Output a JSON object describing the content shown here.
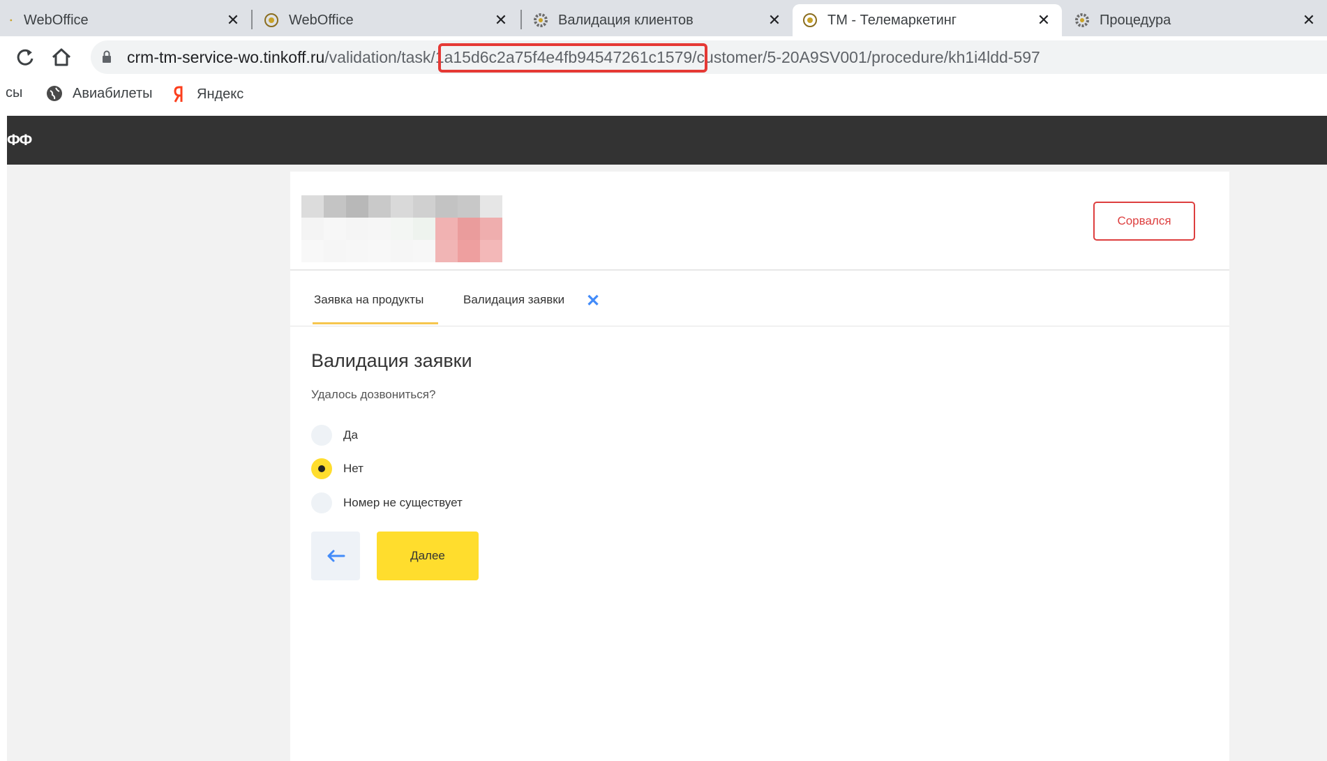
{
  "browser": {
    "tabs": [
      {
        "title": "WebOffice",
        "close": "✕",
        "active": false
      },
      {
        "title": "WebOffice",
        "close": "✕",
        "active": false
      },
      {
        "title": "Валидация клиентов",
        "close": "✕",
        "active": false
      },
      {
        "title": "TM - Телемаркетинг",
        "close": "✕",
        "active": true
      },
      {
        "title": "Процедура",
        "close": "✕",
        "active": false
      }
    ],
    "url": {
      "host": "crm-tm-service-wo.tinkoff.ru",
      "path": "/validation/task/1a15d6c2a75f4e4fb94547261c1579/customer/5-20A9SV001/procedure/kh1i4ldd-597"
    },
    "bookmarks": [
      {
        "label": "Авиабилеты",
        "icon": "globe-icon"
      },
      {
        "label": "Яндекс",
        "icon": "yandex-icon"
      }
    ],
    "bookmark_partial": "сы"
  },
  "site": {
    "logo": "ФФ"
  },
  "card": {
    "outline_button": "Сорвался",
    "tabs": [
      {
        "label": "Заявка на продукты"
      },
      {
        "label": "Валидация заявки"
      }
    ],
    "tab_close": "✕",
    "section_title": "Валидация заявки",
    "question": "Удалось дозвониться?",
    "options": [
      {
        "label": "Да",
        "checked": false
      },
      {
        "label": "Нет",
        "checked": true
      },
      {
        "label": "Номер не существует",
        "checked": false
      }
    ],
    "back_icon": "arrow-left-icon",
    "next_button": "Далее"
  },
  "colors": {
    "accent_yellow": "#ffdd2d",
    "danger_red": "#dd3e3e",
    "link_blue": "#428bf9",
    "header_dark": "#333333"
  }
}
